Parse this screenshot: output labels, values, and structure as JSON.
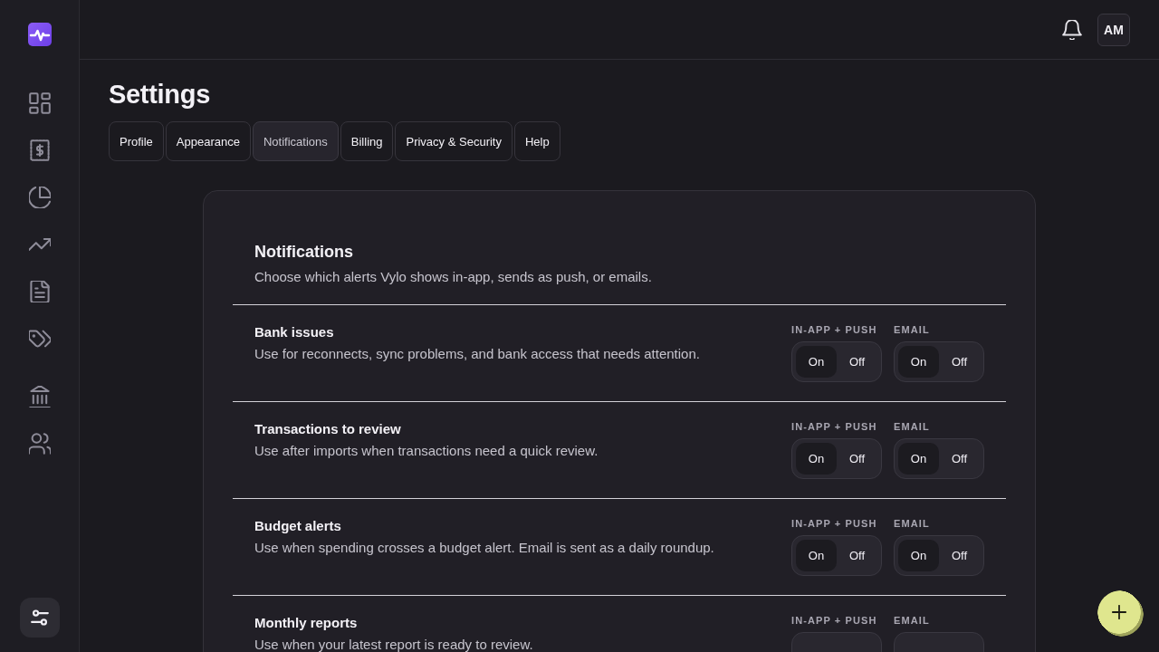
{
  "header": {
    "avatar": "AM"
  },
  "title": "Settings",
  "tabs": [
    {
      "label": "Profile",
      "selected": false
    },
    {
      "label": "Appearance",
      "selected": false
    },
    {
      "label": "Notifications",
      "selected": true
    },
    {
      "label": "Billing",
      "selected": false
    },
    {
      "label": "Privacy & Security",
      "selected": false
    },
    {
      "label": "Help",
      "selected": false
    }
  ],
  "notifications": {
    "title": "Notifications",
    "description": "Choose which alerts Vylo shows in-app, sends as push, or emails.",
    "rows": [
      {
        "title": "Bank issues",
        "description": "Use for reconnects, sync problems, and bank access that needs attention.",
        "channels": [
          {
            "label": "IN-APP + PUSH",
            "options": [
              {
                "label": "On",
                "selected": true
              },
              {
                "label": "Off",
                "selected": false
              }
            ]
          },
          {
            "label": "EMAIL",
            "options": [
              {
                "label": "On",
                "selected": true
              },
              {
                "label": "Off",
                "selected": false
              }
            ]
          }
        ]
      },
      {
        "title": "Transactions to review",
        "description": "Use after imports when transactions need a quick review.",
        "channels": [
          {
            "label": "IN-APP + PUSH",
            "options": [
              {
                "label": "On",
                "selected": true
              },
              {
                "label": "Off",
                "selected": false
              }
            ]
          },
          {
            "label": "EMAIL",
            "options": [
              {
                "label": "On",
                "selected": true
              },
              {
                "label": "Off",
                "selected": false
              }
            ]
          }
        ]
      },
      {
        "title": "Budget alerts",
        "description": "Use when spending crosses a budget alert. Email is sent as a daily roundup.",
        "channels": [
          {
            "label": "IN-APP + PUSH",
            "options": [
              {
                "label": "On",
                "selected": true
              },
              {
                "label": "Off",
                "selected": false
              }
            ]
          },
          {
            "label": "EMAIL",
            "options": [
              {
                "label": "On",
                "selected": true
              },
              {
                "label": "Off",
                "selected": false
              }
            ]
          }
        ]
      },
      {
        "title": "Monthly reports",
        "description": "Use when your latest report is ready to review.",
        "channels": [
          {
            "label": "IN-APP + PUSH"
          },
          {
            "label": "EMAIL"
          }
        ]
      }
    ]
  }
}
